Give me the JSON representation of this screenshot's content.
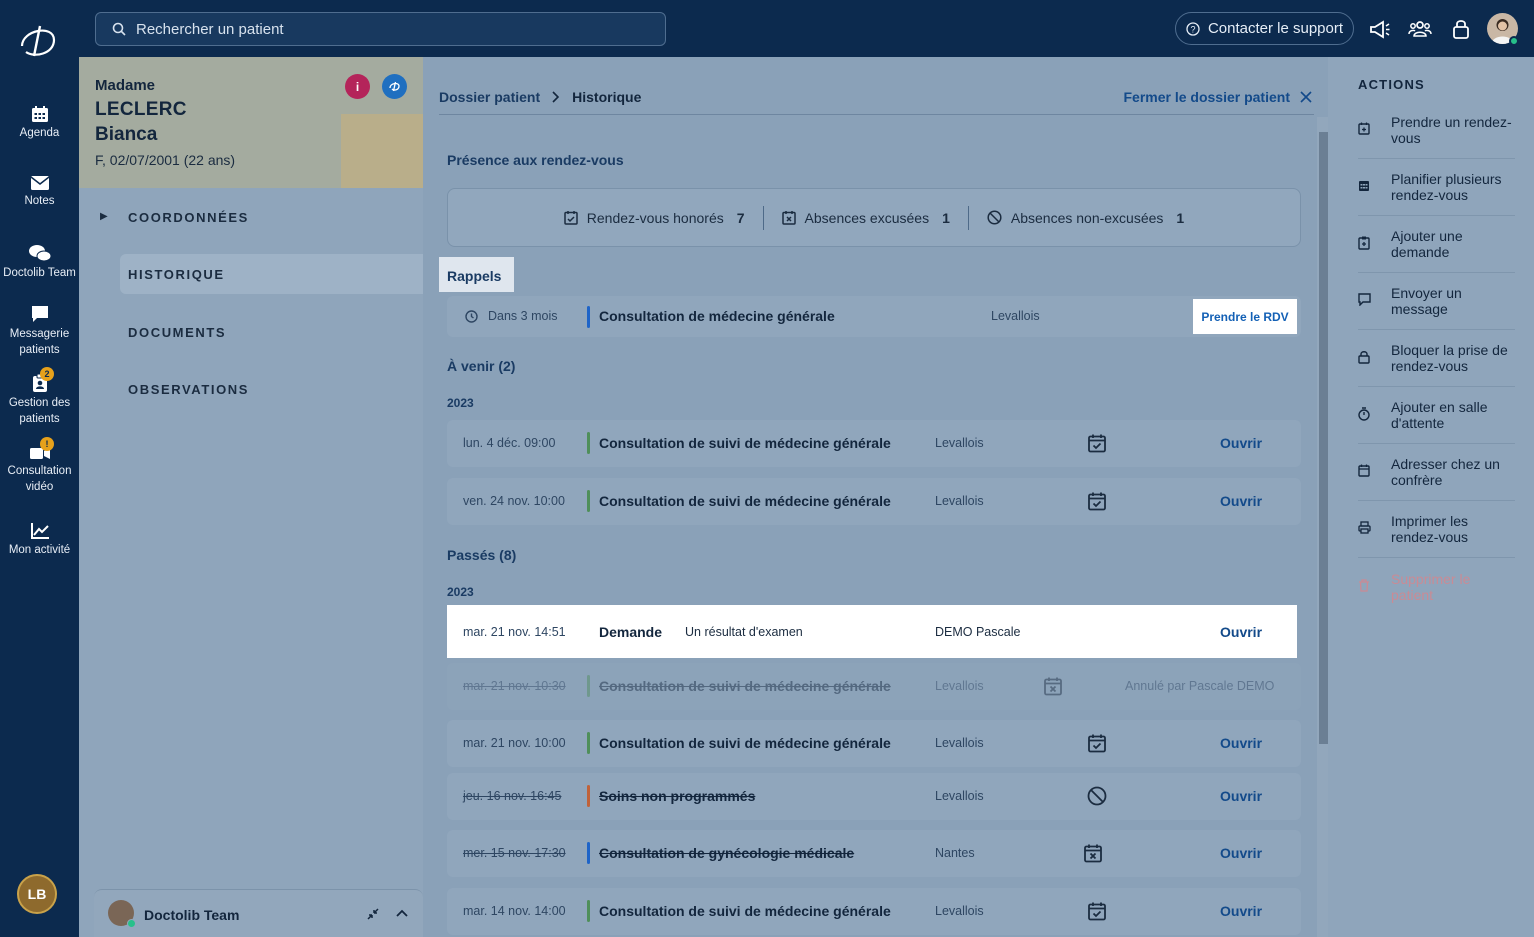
{
  "topbar": {
    "search_placeholder": "Rechercher un patient",
    "support_label": "Contacter le support"
  },
  "leftnav": {
    "items": [
      {
        "label": "Agenda"
      },
      {
        "label": "Notes"
      },
      {
        "label": "Doctolib Team"
      },
      {
        "label": "Messagerie patients"
      },
      {
        "label": "Gestion des patients",
        "badge": "2"
      },
      {
        "label": "Consultation vidéo",
        "badge": "!"
      },
      {
        "label": "Mon activité"
      }
    ],
    "user_initials": "LB"
  },
  "patient": {
    "title": "Madame",
    "last_name": "LECLERC",
    "first_name": "Bianca",
    "info": "F, 02/07/2001 (22 ans)",
    "menu": [
      "COORDONNÉES",
      "HISTORIQUE",
      "DOCUMENTS",
      "OBSERVATIONS"
    ],
    "active_menu": "HISTORIQUE"
  },
  "chat": {
    "name": "Doctolib Team"
  },
  "breadcrumb": {
    "root": "Dossier patient",
    "current": "Historique"
  },
  "close_label": "Fermer le dossier patient",
  "presence": {
    "title": "Présence aux rendez-vous",
    "honored_label": "Rendez-vous honorés",
    "honored_count": "7",
    "excused_label": "Absences excusées",
    "excused_count": "1",
    "unexcused_label": "Absences non-excusées",
    "unexcused_count": "1"
  },
  "rappels": {
    "title": "Rappels",
    "when": "Dans 3 mois",
    "title_text": "Consultation de médecine générale",
    "place": "Levallois",
    "button": "Prendre le RDV"
  },
  "upcoming": {
    "title": "À venir (2)",
    "year": "2023",
    "rows": [
      {
        "date": "lun. 4 déc. 09:00",
        "title": "Consultation de suivi de médecine générale",
        "place": "Levallois",
        "action": "Ouvrir"
      },
      {
        "date": "ven. 24 nov. 10:00",
        "title": "Consultation de suivi de médecine générale",
        "place": "Levallois",
        "action": "Ouvrir"
      }
    ]
  },
  "past": {
    "title": "Passés (8)",
    "year": "2023",
    "demande": {
      "date": "mar. 21 nov. 14:51",
      "label": "Demande",
      "desc": "Un résultat d'examen",
      "person": "DEMO Pascale",
      "action": "Ouvrir"
    },
    "cancelled": {
      "date": "mar. 21 nov. 10:30",
      "title": "Consultation de suivi de médecine générale",
      "place": "Levallois",
      "note": "Annulé par Pascale DEMO"
    },
    "rows": [
      {
        "date": "mar. 21 nov. 10:00",
        "title": "Consultation de suivi de médecine générale",
        "place": "Levallois",
        "action": "Ouvrir"
      },
      {
        "date": "jeu. 16 nov. 16:45",
        "title": "Soins non programmés",
        "place": "Levallois",
        "action": "Ouvrir"
      },
      {
        "date": "mer. 15 nov. 17:30",
        "title": "Consultation de gynécologie médicale",
        "place": "Nantes",
        "action": "Ouvrir"
      },
      {
        "date": "mar. 14 nov. 14:00",
        "title": "Consultation de suivi de médecine générale",
        "place": "Levallois",
        "action": "Ouvrir"
      }
    ]
  },
  "actions": {
    "title": "ACTIONS",
    "items": [
      "Prendre un rendez-vous",
      "Planifier plusieurs rendez-vous",
      "Ajouter une demande",
      "Envoyer un message",
      "Bloquer la prise de rendez-vous",
      "Ajouter en salle d'attente",
      "Adresser chez un confrère",
      "Imprimer les rendez-vous",
      "Supprimer le patient"
    ]
  },
  "colors": {
    "navy": "#0c2a4e",
    "link_blue": "#134a8a",
    "bar_blue": "#1e64c8",
    "bar_green": "#4f8f5a",
    "bar_orange": "#c0623a"
  }
}
